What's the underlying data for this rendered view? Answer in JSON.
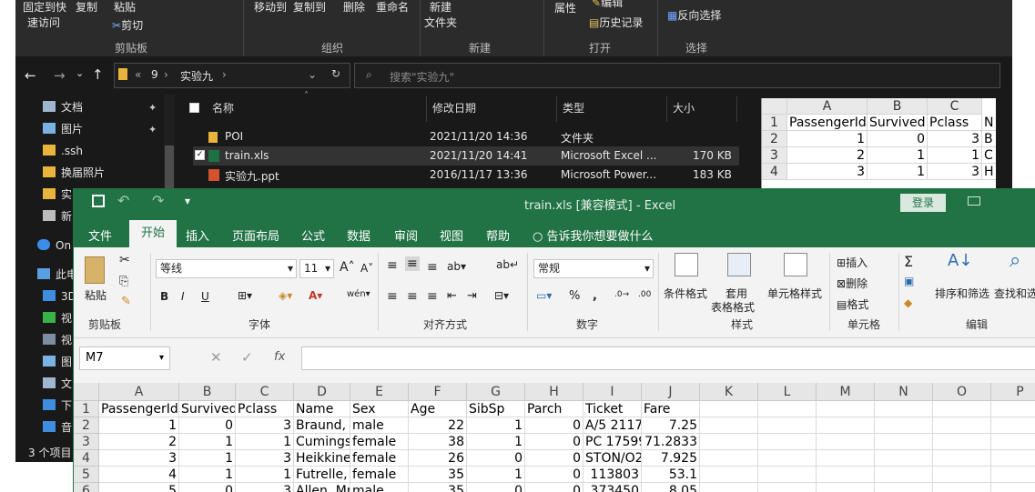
{
  "explorer": {
    "ribbon": {
      "pin_quick": "固定到快",
      "pin_quick2": "速访问",
      "copy": "复制",
      "paste": "粘贴",
      "cut": "剪切",
      "move_to": "移动到",
      "copy_to": "复制到",
      "delete": "删除",
      "rename": "重命名",
      "new": "新建",
      "new_folder": "文件夹",
      "properties": "属性",
      "edit": "编辑",
      "history": "历史记录",
      "invert_select": "反向选择",
      "grp_clipboard": "剪贴板",
      "grp_organize": "组织",
      "grp_new": "新建",
      "grp_open": "打开",
      "grp_select": "选择"
    },
    "address": {
      "part1": "9",
      "part2": "实验九",
      "search_placeholder": "搜索\"实验九\""
    },
    "nav": [
      {
        "label": "文档",
        "pinned": true
      },
      {
        "label": "图片",
        "pinned": true
      },
      {
        "label": ".ssh",
        "pinned": false
      },
      {
        "label": "换届照片",
        "pinned": false
      },
      {
        "label": "实",
        "pinned": false
      },
      {
        "label": "新",
        "pinned": false
      },
      {
        "label": "On",
        "pinned": false
      },
      {
        "label": "此电",
        "pinned": false
      },
      {
        "label": "3D",
        "pinned": false
      },
      {
        "label": "视",
        "pinned": false
      },
      {
        "label": "视",
        "pinned": false
      },
      {
        "label": "图",
        "pinned": false
      },
      {
        "label": "文",
        "pinned": false
      },
      {
        "label": "下",
        "pinned": false
      },
      {
        "label": "音",
        "pinned": false
      }
    ],
    "columns": {
      "name": "名称",
      "date": "修改日期",
      "type": "类型",
      "size": "大小"
    },
    "files": [
      {
        "name": "POI",
        "date": "2021/11/20 14:36",
        "type": "文件夹",
        "size": ""
      },
      {
        "name": "train.xls",
        "date": "2021/11/20 14:41",
        "type": "Microsoft Excel ...",
        "size": "170 KB"
      },
      {
        "name": "实验九.ppt",
        "date": "2016/11/17 13:36",
        "type": "Microsoft Power...",
        "size": "183 KB"
      }
    ],
    "status": "3 个项目"
  },
  "mini_sheet": {
    "cols": [
      "A",
      "B",
      "C"
    ],
    "rows": [
      [
        "1",
        "PassengerId",
        "Survived",
        "Pclass"
      ],
      [
        "2",
        "1",
        "0",
        "3"
      ],
      [
        "3",
        "2",
        "1",
        "1"
      ],
      [
        "4",
        "3",
        "1",
        "3"
      ]
    ],
    "extra": [
      "N",
      "B",
      "C",
      "H"
    ]
  },
  "excel": {
    "title": "train.xls  [兼容模式]  -  Excel",
    "login": "登录",
    "tabs": [
      "文件",
      "开始",
      "插入",
      "页面布局",
      "公式",
      "数据",
      "审阅",
      "视图",
      "帮助"
    ],
    "tell_me": "告诉我你想要做什么",
    "ribbon": {
      "paste": "粘贴",
      "font_name": "等线",
      "font_size": "11",
      "number_format": "常规",
      "cond_format": "条件格式",
      "table_format1": "套用",
      "table_format2": "表格格式",
      "cell_style": "单元格样式",
      "insert": "插入",
      "delete": "删除",
      "format": "格式",
      "sort_filter": "排序和筛选",
      "find_select": "查找和选",
      "grp_clipboard": "剪贴板",
      "grp_font": "字体",
      "grp_align": "对齐方式",
      "grp_number": "数字",
      "grp_styles": "样式",
      "grp_cells": "单元格",
      "grp_edit": "编辑",
      "bold": "B",
      "italic": "I",
      "underline": "U"
    },
    "name_box": "M7",
    "fx": "fx",
    "columns": [
      "A",
      "B",
      "C",
      "D",
      "E",
      "F",
      "G",
      "H",
      "I",
      "J",
      "K",
      "L",
      "M",
      "N",
      "O",
      "P"
    ],
    "rows": [
      [
        "1",
        "PassengerId",
        "Survived",
        "Pclass",
        "Name",
        "Sex",
        "Age",
        "SibSp",
        "Parch",
        "Ticket",
        "Fare"
      ],
      [
        "2",
        "1",
        "0",
        "3",
        "Braund, M",
        "male",
        "22",
        "1",
        "0",
        "A/5 2117",
        "7.25"
      ],
      [
        "3",
        "2",
        "1",
        "1",
        "Cumings,",
        "female",
        "38",
        "1",
        "0",
        "PC 17599",
        "71.2833"
      ],
      [
        "4",
        "3",
        "1",
        "3",
        "Heikkinen",
        "female",
        "26",
        "0",
        "0",
        "STON/O2",
        "7.925"
      ],
      [
        "5",
        "4",
        "1",
        "1",
        "Futrelle, M",
        "female",
        "35",
        "1",
        "0",
        "113803",
        "53.1"
      ],
      [
        "6",
        "5",
        "0",
        "3",
        "Allen, Mr.",
        "male",
        "35",
        "0",
        "0",
        "373450",
        "8.05"
      ]
    ]
  }
}
